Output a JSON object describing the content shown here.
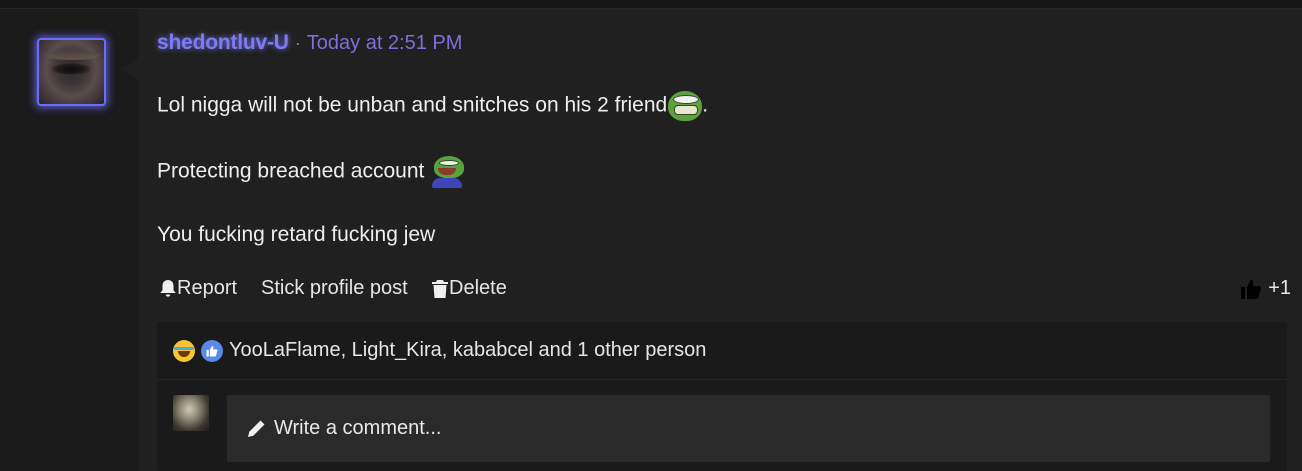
{
  "post": {
    "username": "shedontluv-U",
    "separator": "·",
    "timestamp": "Today at 2:51 PM",
    "lines": [
      "Lol nigga will not be unban and snitches on his 2 friend",
      "Protecting breached account",
      "You fucking retard fucking jew"
    ],
    "line1_suffix": ".",
    "emojis": [
      "pepe-grin-emoji",
      "pepe-laugh-emoji"
    ]
  },
  "actions": {
    "report_label": "Report",
    "stick_label": "Stick profile post",
    "delete_label": "Delete",
    "like_count": "+1"
  },
  "reactions": {
    "icons": [
      "laugh-reaction-icon",
      "like-reaction-icon"
    ],
    "text": "YooLaFlame, Light_Kira, kababcel and 1 other person"
  },
  "comment": {
    "placeholder": "Write a comment..."
  },
  "colors": {
    "username": "#7c7cf0",
    "timestamp": "#7d6fdc",
    "background": "#1a1a1a",
    "post_background": "#202020"
  }
}
